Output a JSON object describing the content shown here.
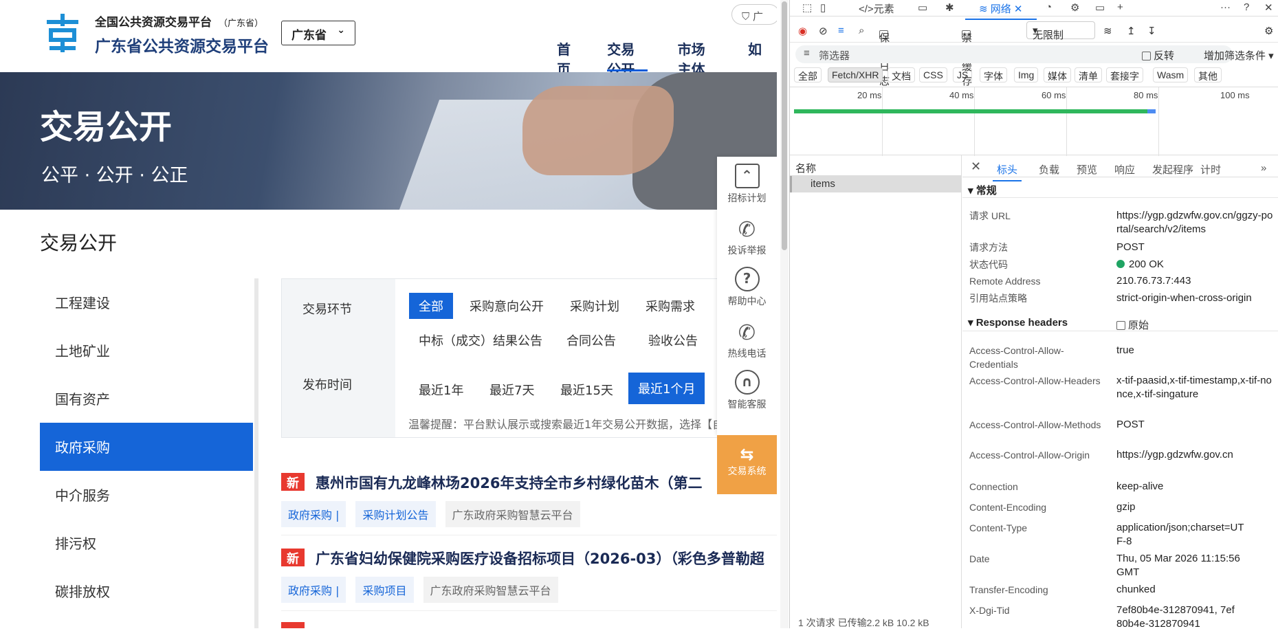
{
  "site": {
    "brand_line1": "全国公共资源交易平台",
    "brand_line1_suffix": "（广东省）",
    "brand_line2": "广东省公共资源交易平台",
    "province": "广东省",
    "lang_btn": "广",
    "nav": [
      "首页",
      "交易公开",
      "市场主体",
      "如"
    ],
    "banner_title": "交易公开",
    "banner_sub": "公平 · 公开 · 公正",
    "page_title": "交易公开",
    "sidebar": [
      "工程建设",
      "土地矿业",
      "国有资产",
      "政府采购",
      "中介服务",
      "排污权",
      "碳排放权"
    ],
    "filter": {
      "stage_label": "交易环节",
      "stage_opts": [
        "全部",
        "采购意向公开",
        "采购计划",
        "采购需求",
        "中标（成交）结果公告",
        "合同公告",
        "验收公告"
      ],
      "time_label": "发布时间",
      "time_opts": [
        "最近1年",
        "最近7天",
        "最近15天",
        "最近1个月"
      ],
      "hint": "温馨提醒：平台默认展示或搜索最近1年交易公开数据，选择【自定义"
    },
    "notices": [
      {
        "tag": "新",
        "title": "惠州市国有九龙峰林场2026年支持全市乡村绿化苗木（第二",
        "tags": [
          "政府采购 |",
          "采购计划公告",
          "广东政府采购智慧云平台"
        ]
      },
      {
        "tag": "新",
        "title": "广东省妇幼保健院采购医疗设备招标项目（2026-03）（彩色多普勒超",
        "tags": [
          "政府采购 |",
          "采购项目",
          "广东政府采购智慧云平台"
        ]
      }
    ],
    "float": [
      "招标计划",
      "投诉举报",
      "帮助中心",
      "热线电话",
      "智能客服"
    ],
    "trade_btn": "交易系统"
  },
  "devtools": {
    "tabs": [
      "元素",
      "网络"
    ],
    "toolbar": {
      "preserve_log": "保留日志",
      "disable_cache": "禁用缓存",
      "throttle": "无限制"
    },
    "filter_placeholder": "筛选器",
    "invert": "反转",
    "more_filters": "增加筛选条件",
    "chips": [
      "全部",
      "Fetch/XHR",
      "文档",
      "CSS",
      "JS",
      "字体",
      "Img",
      "媒体",
      "清单",
      "套接字",
      "Wasm",
      "其他"
    ],
    "ticks": [
      "20 ms",
      "40 ms",
      "60 ms",
      "80 ms",
      "100 ms"
    ],
    "name_header": "名称",
    "request": "items",
    "status_bar": "1 次请求   已传输2.2 kB   10.2 kB",
    "detail_tabs": [
      "标头",
      "负载",
      "预览",
      "响应",
      "发起程序",
      "计时"
    ],
    "general_title": "▾ 常规",
    "general": [
      {
        "k": "请求 URL",
        "v": "https://ygp.gdzwfw.gov.cn/ggzy-portal/search/v2/items"
      },
      {
        "k": "请求方法",
        "v": "POST"
      },
      {
        "k": "状态代码",
        "v": "200 OK"
      },
      {
        "k": "Remote Address",
        "v": "210.76.73.7:443"
      },
      {
        "k": "引用站点策略",
        "v": "strict-origin-when-cross-origin"
      }
    ],
    "resp_title": "▾ Response headers",
    "raw": "原始",
    "resp": [
      {
        "k": "Access-Control-Allow-Credentials",
        "v": "true"
      },
      {
        "k": "Access-Control-Allow-Headers",
        "v": "x-tif-paasid,x-tif-timestamp,x-tif-nonce,x-tif-singature"
      },
      {
        "k": "Access-Control-Allow-Methods",
        "v": "POST"
      },
      {
        "k": "Access-Control-Allow-Origin",
        "v": "https://ygp.gdzwfw.gov.cn"
      },
      {
        "k": "Connection",
        "v": "keep-alive"
      },
      {
        "k": "Content-Encoding",
        "v": "gzip"
      },
      {
        "k": "Content-Type",
        "v": "application/json;charset=UTF-8"
      },
      {
        "k": "Date",
        "v": "Thu, 05 Mar 2026 11:15:56 GMT"
      },
      {
        "k": "Transfer-Encoding",
        "v": "chunked"
      },
      {
        "k": "X-Dgi-Tid",
        "v": "7ef80b4e-312870941, 7ef80b4e-312870941"
      }
    ]
  }
}
